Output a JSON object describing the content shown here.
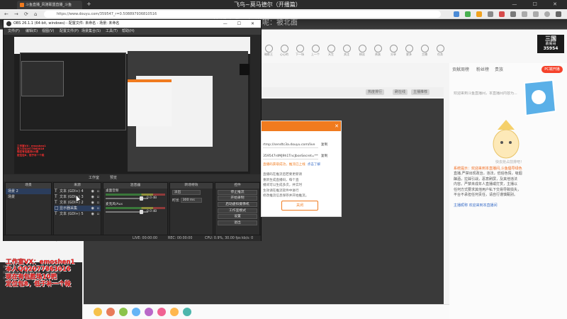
{
  "browser": {
    "tab_title": "斗鱼直播_风驰联盟直播_斗鱼",
    "window_title": "飞鸟~莫马德尔（开播篇）",
    "url": "https://www.douyu.com/359547_r=0.508897936810516",
    "nav_icons": [
      "back-icon",
      "forward-icon",
      "refresh-icon",
      "home-icon"
    ],
    "win_controls": "— ☐ ✕"
  },
  "page": {
    "anchor_title": "的播出我不知道呢：被北面",
    "gifts": [
      "暗影王",
      "心心的",
      "下一场",
      "上一个",
      "天生",
      "关注",
      "粉丝",
      "贵族",
      "分享",
      "更多",
      "主播",
      "任务"
    ],
    "room_badge": {
      "line1": "三国",
      "line2": "慕阁哥",
      "num": "35954"
    },
    "player_bar": [
      "热度排行",
      "刷在线",
      "主播推荐"
    ],
    "rank_tabs": [
      "贡献周榜",
      "粉丝榜",
      "贵族"
    ],
    "rank_pill": "PC端开播",
    "notice": "欢迎来到斗鱼直播间，本直播间内容为...",
    "mascot_text": "快去抢占前排吧！",
    "chat": [
      {
        "style": "hi",
        "text": "系统提示：欢迎来到本直播间,斗鱼倡导绿色"
      },
      {
        "style": "",
        "text": "直播,严禁出现政治，违法，低俗色情，吸烟"
      },
      {
        "style": "",
        "text": "酗酒，拉踩引战，恶意刷屏，及其他违法"
      },
      {
        "style": "",
        "text": "内容。严禁未成年人直播或打赏，主播以"
      },
      {
        "style": "",
        "text": "任何方式要求其他用户私下交易导致损失，"
      },
      {
        "style": "",
        "text": "平台不承担任何责任，请自行谨慎甄别。"
      },
      {
        "style": "",
        "text": ""
      },
      {
        "style": "sys",
        "text": "主播昵称 欢迎来到本直播间"
      }
    ],
    "promo_lines": [
      "工作室VX：emoshen1",
      "本人QQ2077863016",
      "现在有包胜场10把",
      "定位包8，低于补一个段"
    ]
  },
  "obs": {
    "title": "OBS 26.1.1 (64-bit, windows) - 配置文件: 未命名 - 场景: 未命名",
    "menu": [
      "文件(F)",
      "编辑(E)",
      "视图(V)",
      "配置文件(P)",
      "场景集合(S)",
      "工具(T)",
      "帮助(H)"
    ],
    "strip": {
      "studio": "工作室",
      "preview": "预览"
    },
    "docks": {
      "scenes": {
        "header": "场景",
        "items": [
          "场景 2",
          "场景"
        ]
      },
      "sources": {
        "header": "来源",
        "items": [
          {
            "name": "文本 (GDI+) 4",
            "type": "T"
          },
          {
            "name": "文本 (GDI+) 3",
            "type": "T"
          },
          {
            "name": "文本 (GDI+) 2",
            "type": "T"
          },
          {
            "name": "显示器采集",
            "type": "□"
          },
          {
            "name": "文本 (GDI+) 5",
            "type": "T"
          }
        ]
      },
      "mixer": {
        "header": "混音器",
        "items": [
          {
            "name": "桌面音频",
            "vol": "0.0 dB",
            "level": 0.84
          },
          {
            "name": "麦克风/Aux",
            "vol": "0.0 dB",
            "level": 0.84
          }
        ]
      },
      "transitions": {
        "header": "转场特效",
        "fade": "淡出",
        "duration_label": "时长",
        "duration": "300 ms"
      },
      "controls": {
        "header": "控件",
        "buttons": [
          "停止推流",
          "开始录制",
          "启动虚拟摄像机",
          "工作室模式",
          "设置",
          "退出"
        ]
      }
    },
    "status": {
      "live": "LIVE: 00:00:00",
      "rec": "REC: 00:00:00",
      "cpu": "CPU: 0.9%, 30.00 fps",
      "kbps": "kb/s: 0"
    }
  },
  "dialog": {
    "url": "rtmp://sendtc3a.douyu.com/live",
    "key": "359547rdMJ9h1TncJbseSecret=********",
    "copy1": "复制",
    "copy2": "复制",
    "status": "直播码获取成功，推流已上线",
    "learn": "点击了解",
    "text": [
      "直播码在推流后若要更新请",
      "重新生成直播码，每个直",
      "播间可以生成多次，并实时",
      "生效请在推流软件中进行",
      "修改推流信息保存并开始推流。"
    ],
    "btn": "关闭"
  },
  "colors": {
    "accent": "#f07b1f",
    "promo": "#ff2525",
    "obs_bg": "#272727"
  }
}
